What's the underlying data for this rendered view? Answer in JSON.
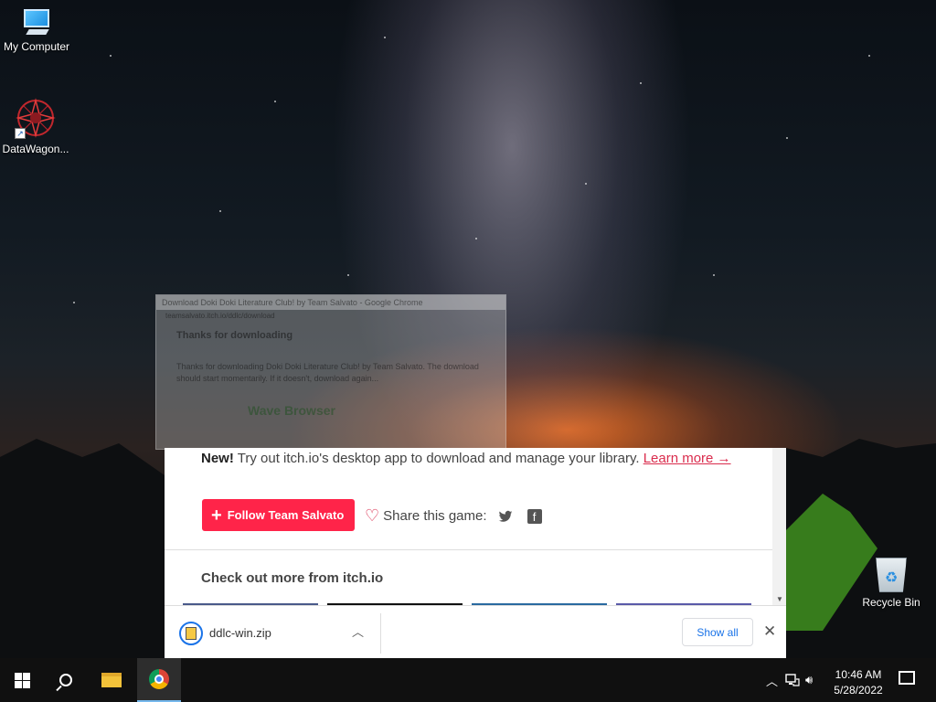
{
  "desktop": {
    "icons": [
      {
        "label": "My Computer",
        "icon": "computer-icon"
      },
      {
        "label": "DataWagon...",
        "icon": "datawagon-icon"
      },
      {
        "label": "Recycle Bin",
        "icon": "recycle-bin-icon"
      }
    ]
  },
  "ghost_window": {
    "title": "Download Doki Doki Literature Club! by Team Salvato - Google Chrome",
    "url": "teamsalvato.itch.io/ddlc/download",
    "heading": "Thanks for downloading",
    "body": "Thanks for downloading Doki Doki Literature Club! by Team Salvato. The download should start momentarily. If it doesn't, download again...",
    "ad": "Wave Browser"
  },
  "page": {
    "new_label": "New!",
    "new_text": " Try out itch.io's desktop app to download and manage your library. ",
    "learn_more": "Learn more →",
    "follow_button": "Follow Team Salvato",
    "share_label": "Share this game:",
    "check_out": "Check out more from itch.io"
  },
  "download_bar": {
    "file_name": "ddlc-win.zip",
    "show_all": "Show all"
  },
  "taskbar": {
    "time": "10:46 AM",
    "date": "5/28/2022"
  },
  "colors": {
    "itch_red": "#ff2449",
    "link": "#da2c4d",
    "chrome_blue": "#1a73e8",
    "taskbar": "#101010"
  }
}
